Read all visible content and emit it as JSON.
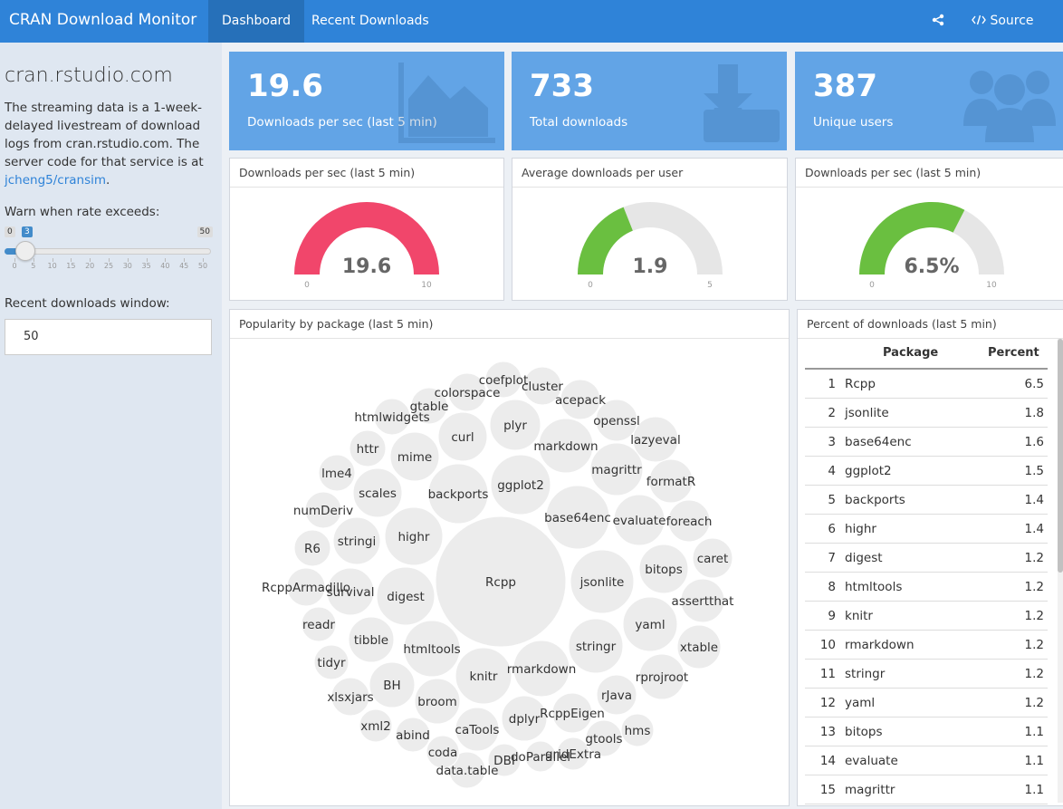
{
  "navbar": {
    "brand": "CRAN Download Monitor",
    "tabs": [
      {
        "label": "Dashboard",
        "active": true
      },
      {
        "label": "Recent Downloads",
        "active": false
      }
    ],
    "share_icon": "share-icon",
    "source_code_label": "Source Code",
    "source_code_icon": "code-icon"
  },
  "sidebar": {
    "title": "cran.rstudio.com",
    "description": "The streaming data is a 1-week-delayed livestream of download logs from cran.rstudio.com. The server code for that service is at",
    "link_text": "jcheng5/cransim",
    "period": ".",
    "rate_label": "Warn when rate exceeds:",
    "slider": {
      "min": "0",
      "max": "50",
      "value": "3",
      "ticks": [
        "0",
        "5",
        "10",
        "15",
        "20",
        "25",
        "30",
        "35",
        "40",
        "45",
        "50"
      ]
    },
    "window_label": "Recent downloads window:",
    "window_value": "50"
  },
  "value_boxes": [
    {
      "value": "19.6",
      "label": "Downloads per sec (last 5 min)",
      "icon": "area-chart-icon"
    },
    {
      "value": "733",
      "label": "Total downloads",
      "icon": "download-icon"
    },
    {
      "value": "387",
      "label": "Unique users",
      "icon": "users-icon"
    }
  ],
  "gauges": [
    {
      "title": "Downloads per sec (last 5 min)",
      "value": 19.6,
      "display": "19.6",
      "min": "0",
      "max": "10",
      "color": "#f1466b"
    },
    {
      "title": "Average downloads per user",
      "value": 1.9,
      "display": "1.9",
      "min": "0",
      "max": "5",
      "color": "#6abf40"
    },
    {
      "title": "Downloads per sec (last 5 min)",
      "value": 6.5,
      "display": "6.5%",
      "min": "0",
      "max": "10",
      "color": "#6abf40"
    }
  ],
  "bubble_panel": {
    "title": "Popularity by package (last 5 min)",
    "bubbles": [
      "Rcpp",
      "jsonlite",
      "base64enc",
      "ggplot2",
      "backports",
      "highr",
      "digest",
      "htmltools",
      "knitr",
      "rmarkdown",
      "stringr",
      "yaml",
      "bitops",
      "evaluate",
      "magrittr",
      "markdown",
      "plyr",
      "curl",
      "mime",
      "scales",
      "stringi",
      "survival",
      "tibble",
      "BH",
      "broom",
      "dplyr",
      "caTools",
      "DBI",
      "data.table",
      "xml2",
      "abind",
      "coda",
      "gtools",
      "hms",
      "rJava",
      "RcppEigen",
      "rprojroot",
      "xtable",
      "assertthat",
      "caret",
      "foreach",
      "formatR",
      "lazyeval",
      "openssl",
      "acepack",
      "cluster",
      "coefplot",
      "colorspace",
      "gtable",
      "htmlwidgets",
      "httr",
      "lme4",
      "numDeriv",
      "R6",
      "RcppArmadillo",
      "readr",
      "tidyr",
      "xlsxjars",
      "gridExtra",
      "doParallel"
    ]
  },
  "table_panel": {
    "title": "Percent of downloads (last 5 min)",
    "columns": [
      "Package",
      "Percent"
    ],
    "rows": [
      {
        "n": "1",
        "pkg": "Rcpp",
        "pct": "6.5"
      },
      {
        "n": "2",
        "pkg": "jsonlite",
        "pct": "1.8"
      },
      {
        "n": "3",
        "pkg": "base64enc",
        "pct": "1.6"
      },
      {
        "n": "4",
        "pkg": "ggplot2",
        "pct": "1.5"
      },
      {
        "n": "5",
        "pkg": "backports",
        "pct": "1.4"
      },
      {
        "n": "6",
        "pkg": "highr",
        "pct": "1.4"
      },
      {
        "n": "7",
        "pkg": "digest",
        "pct": "1.2"
      },
      {
        "n": "8",
        "pkg": "htmltools",
        "pct": "1.2"
      },
      {
        "n": "9",
        "pkg": "knitr",
        "pct": "1.2"
      },
      {
        "n": "10",
        "pkg": "rmarkdown",
        "pct": "1.2"
      },
      {
        "n": "11",
        "pkg": "stringr",
        "pct": "1.2"
      },
      {
        "n": "12",
        "pkg": "yaml",
        "pct": "1.2"
      },
      {
        "n": "13",
        "pkg": "bitops",
        "pct": "1.1"
      },
      {
        "n": "14",
        "pkg": "evaluate",
        "pct": "1.1"
      },
      {
        "n": "15",
        "pkg": "magrittr",
        "pct": "1.1"
      }
    ]
  }
}
